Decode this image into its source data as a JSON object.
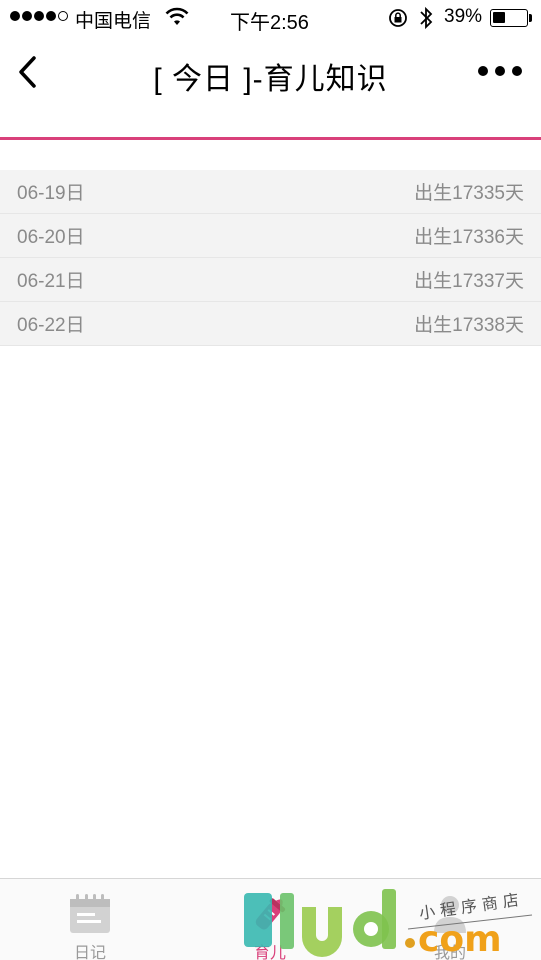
{
  "status_bar": {
    "carrier": "中国电信",
    "time": "下午2:56",
    "battery_percent": "39%",
    "battery_level": 0.39,
    "signal_bars_filled": 4,
    "signal_bars_total": 5
  },
  "nav": {
    "title": "[ 今日 ]-育儿知识",
    "back_icon": "chevron-left-icon",
    "more_icon": "more-dots-icon"
  },
  "accent_color": "#d9407a",
  "list": [
    {
      "date": "06-19日",
      "days": "出生17335天"
    },
    {
      "date": "06-20日",
      "days": "出生17336天"
    },
    {
      "date": "06-21日",
      "days": "出生17337天"
    },
    {
      "date": "06-22日",
      "days": "出生17338天"
    }
  ],
  "tabs": [
    {
      "label": "日记",
      "icon": "calendar-icon",
      "active": false
    },
    {
      "label": "育儿",
      "icon": "baby-bottle-icon",
      "active": true
    },
    {
      "label": "我的",
      "icon": "person-icon",
      "active": false
    }
  ],
  "watermark": {
    "logo": "9lud.com",
    "subtitle": "小程序商店"
  }
}
